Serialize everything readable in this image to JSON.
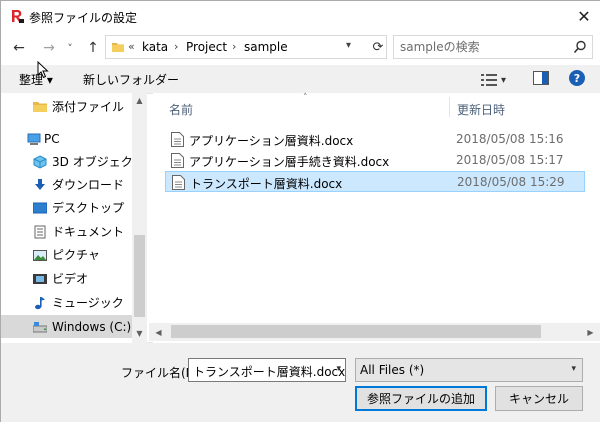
{
  "window": {
    "title": "参照ファイルの設定",
    "close_glyph": "✕"
  },
  "navigation": {
    "back_glyph": "←",
    "forward_glyph": "→",
    "recent_glyph": "˅",
    "up_glyph": "↑",
    "address": {
      "overflow_glyph": "«",
      "segments": [
        "kata",
        "Project",
        "sample"
      ],
      "separator": "›",
      "refresh_glyph": "⟳"
    },
    "search": {
      "placeholder": "sampleの検索"
    }
  },
  "toolbar": {
    "organize_label": "整理 ▾",
    "new_folder_label": "新しいフォルダー",
    "view_dropdown_glyph": "▾",
    "help_label": "?"
  },
  "sidebar": {
    "items": [
      {
        "label": "添付ファイル",
        "icon": "folder-icon"
      },
      {
        "label": "PC",
        "icon": "pc-icon"
      },
      {
        "label": "3D オブジェクト",
        "icon": "3d-objects-icon"
      },
      {
        "label": "ダウンロード",
        "icon": "download-icon"
      },
      {
        "label": "デスクトップ",
        "icon": "desktop-icon"
      },
      {
        "label": "ドキュメント",
        "icon": "documents-icon"
      },
      {
        "label": "ピクチャ",
        "icon": "pictures-icon"
      },
      {
        "label": "ビデオ",
        "icon": "videos-icon"
      },
      {
        "label": "ミュージック",
        "icon": "music-icon"
      },
      {
        "label": "Windows (C:)",
        "icon": "drive-icon"
      }
    ]
  },
  "file_list": {
    "columns": {
      "name": "名前",
      "modified": "更新日時"
    },
    "sort_glyph": "˄",
    "rows": [
      {
        "name": "アプリケーション層資料.docx",
        "modified": "2018/05/08 15:16",
        "selected": false
      },
      {
        "name": "アプリケーション層手続き資料.docx",
        "modified": "2018/05/08 15:17",
        "selected": false
      },
      {
        "name": "トランスポート層資料.docx",
        "modified": "2018/05/08 15:29",
        "selected": true
      }
    ]
  },
  "scroll_glyphs": {
    "up": "▲",
    "down": "▼",
    "left": "◀",
    "right": "▶"
  },
  "footer": {
    "filename_label": "ファイル名(N):",
    "filename_value": "トランスポート層資料.docx",
    "filetype_value": "All Files (*)",
    "dropdown_glyph": "▾",
    "ok_label": "参照ファイルの追加",
    "cancel_label": "キャンセル"
  },
  "colors": {
    "accent": "#0078d7",
    "selection_bg": "#cce8ff",
    "selection_border": "#99d1ff",
    "app_icon_red": "#d9262c"
  }
}
